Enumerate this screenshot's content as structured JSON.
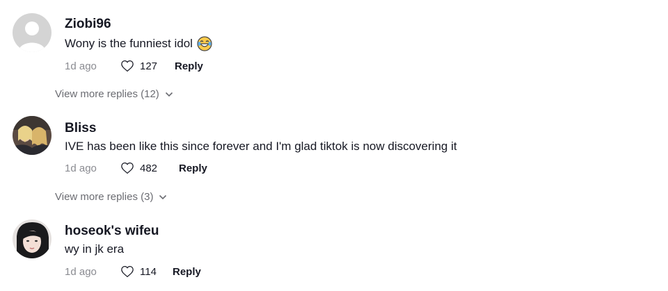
{
  "comments": [
    {
      "username": "Ziobi96",
      "text": "Wony is the funniest idol",
      "emoji": "face-with-tears-of-joy",
      "time": "1d ago",
      "likes": "127",
      "reply_label": "Reply",
      "view_more": "View more replies (12)",
      "avatar": "default-avatar"
    },
    {
      "username": "Bliss",
      "text": "IVE has been like this since forever and I'm glad tiktok is now discovering it",
      "time": "1d ago",
      "likes": "482",
      "reply_label": "Reply",
      "view_more": "View more replies (3)",
      "avatar": "photo-avatar"
    },
    {
      "username": "hoseok's wifeu",
      "text": "wy in jk era",
      "time": "1d ago",
      "likes": "114",
      "reply_label": "Reply",
      "avatar": "photo-avatar"
    }
  ],
  "colors": {
    "text_primary": "#161823",
    "text_secondary": "#8a8b91",
    "default_avatar_bg": "#d0d0d0"
  }
}
